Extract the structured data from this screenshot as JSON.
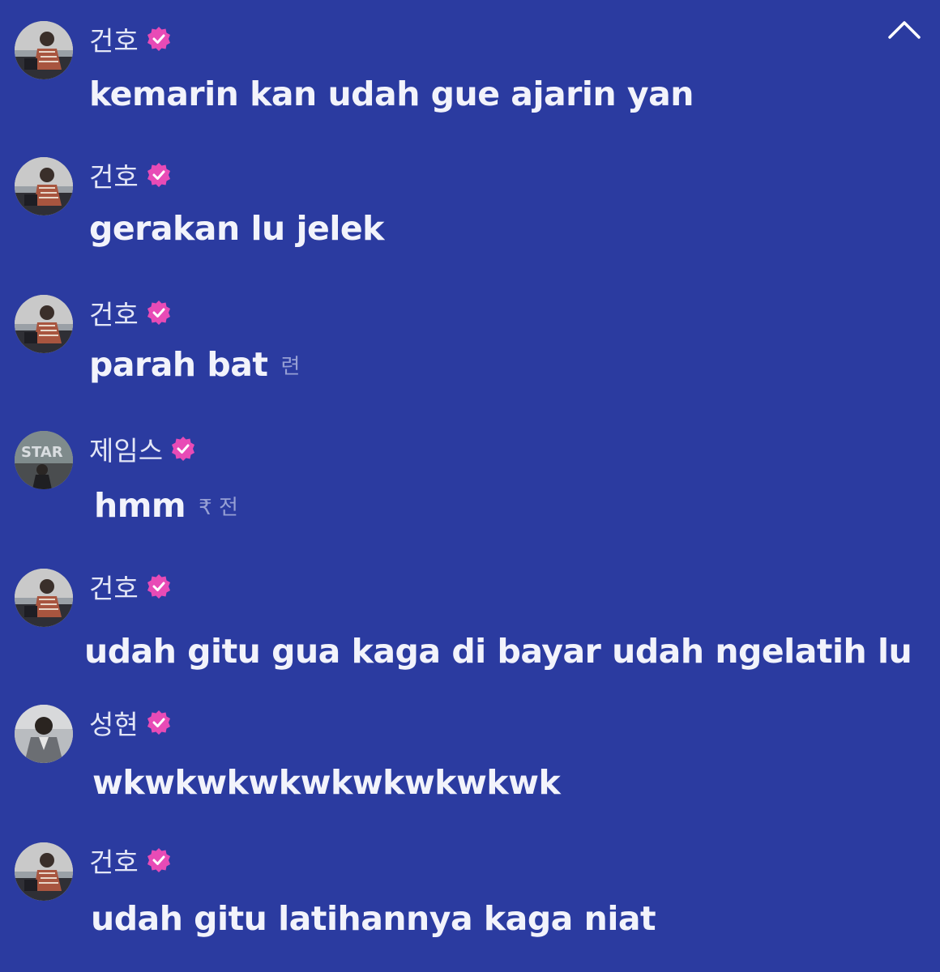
{
  "colors": {
    "background": "#2b3ba0",
    "verified_badge": "#e84bb6",
    "text": "#f2f3fb",
    "name": "#e3e6f6"
  },
  "header": {
    "collapse_icon": "chevron-up-icon"
  },
  "messages": [
    {
      "user": "건호",
      "verified": true,
      "text": "kemarin kan udah gue ajarin yan",
      "time": ""
    },
    {
      "user": "건호",
      "verified": true,
      "text": "gerakan lu jelek",
      "time": ""
    },
    {
      "user": "건호",
      "verified": true,
      "text": "parah bat",
      "time": "련"
    },
    {
      "user": "제임스",
      "verified": true,
      "text": "hmm",
      "time": "₹ 전"
    },
    {
      "user": "건호",
      "verified": true,
      "text": "udah gitu gua kaga di bayar udah ngelatih lu",
      "time": ""
    },
    {
      "user": "성현",
      "verified": true,
      "text": "wkwkwkwkwkwkwkwkwk",
      "time": ""
    },
    {
      "user": "건호",
      "verified": true,
      "text": "udah gitu latihannya kaga niat",
      "time": ""
    }
  ]
}
